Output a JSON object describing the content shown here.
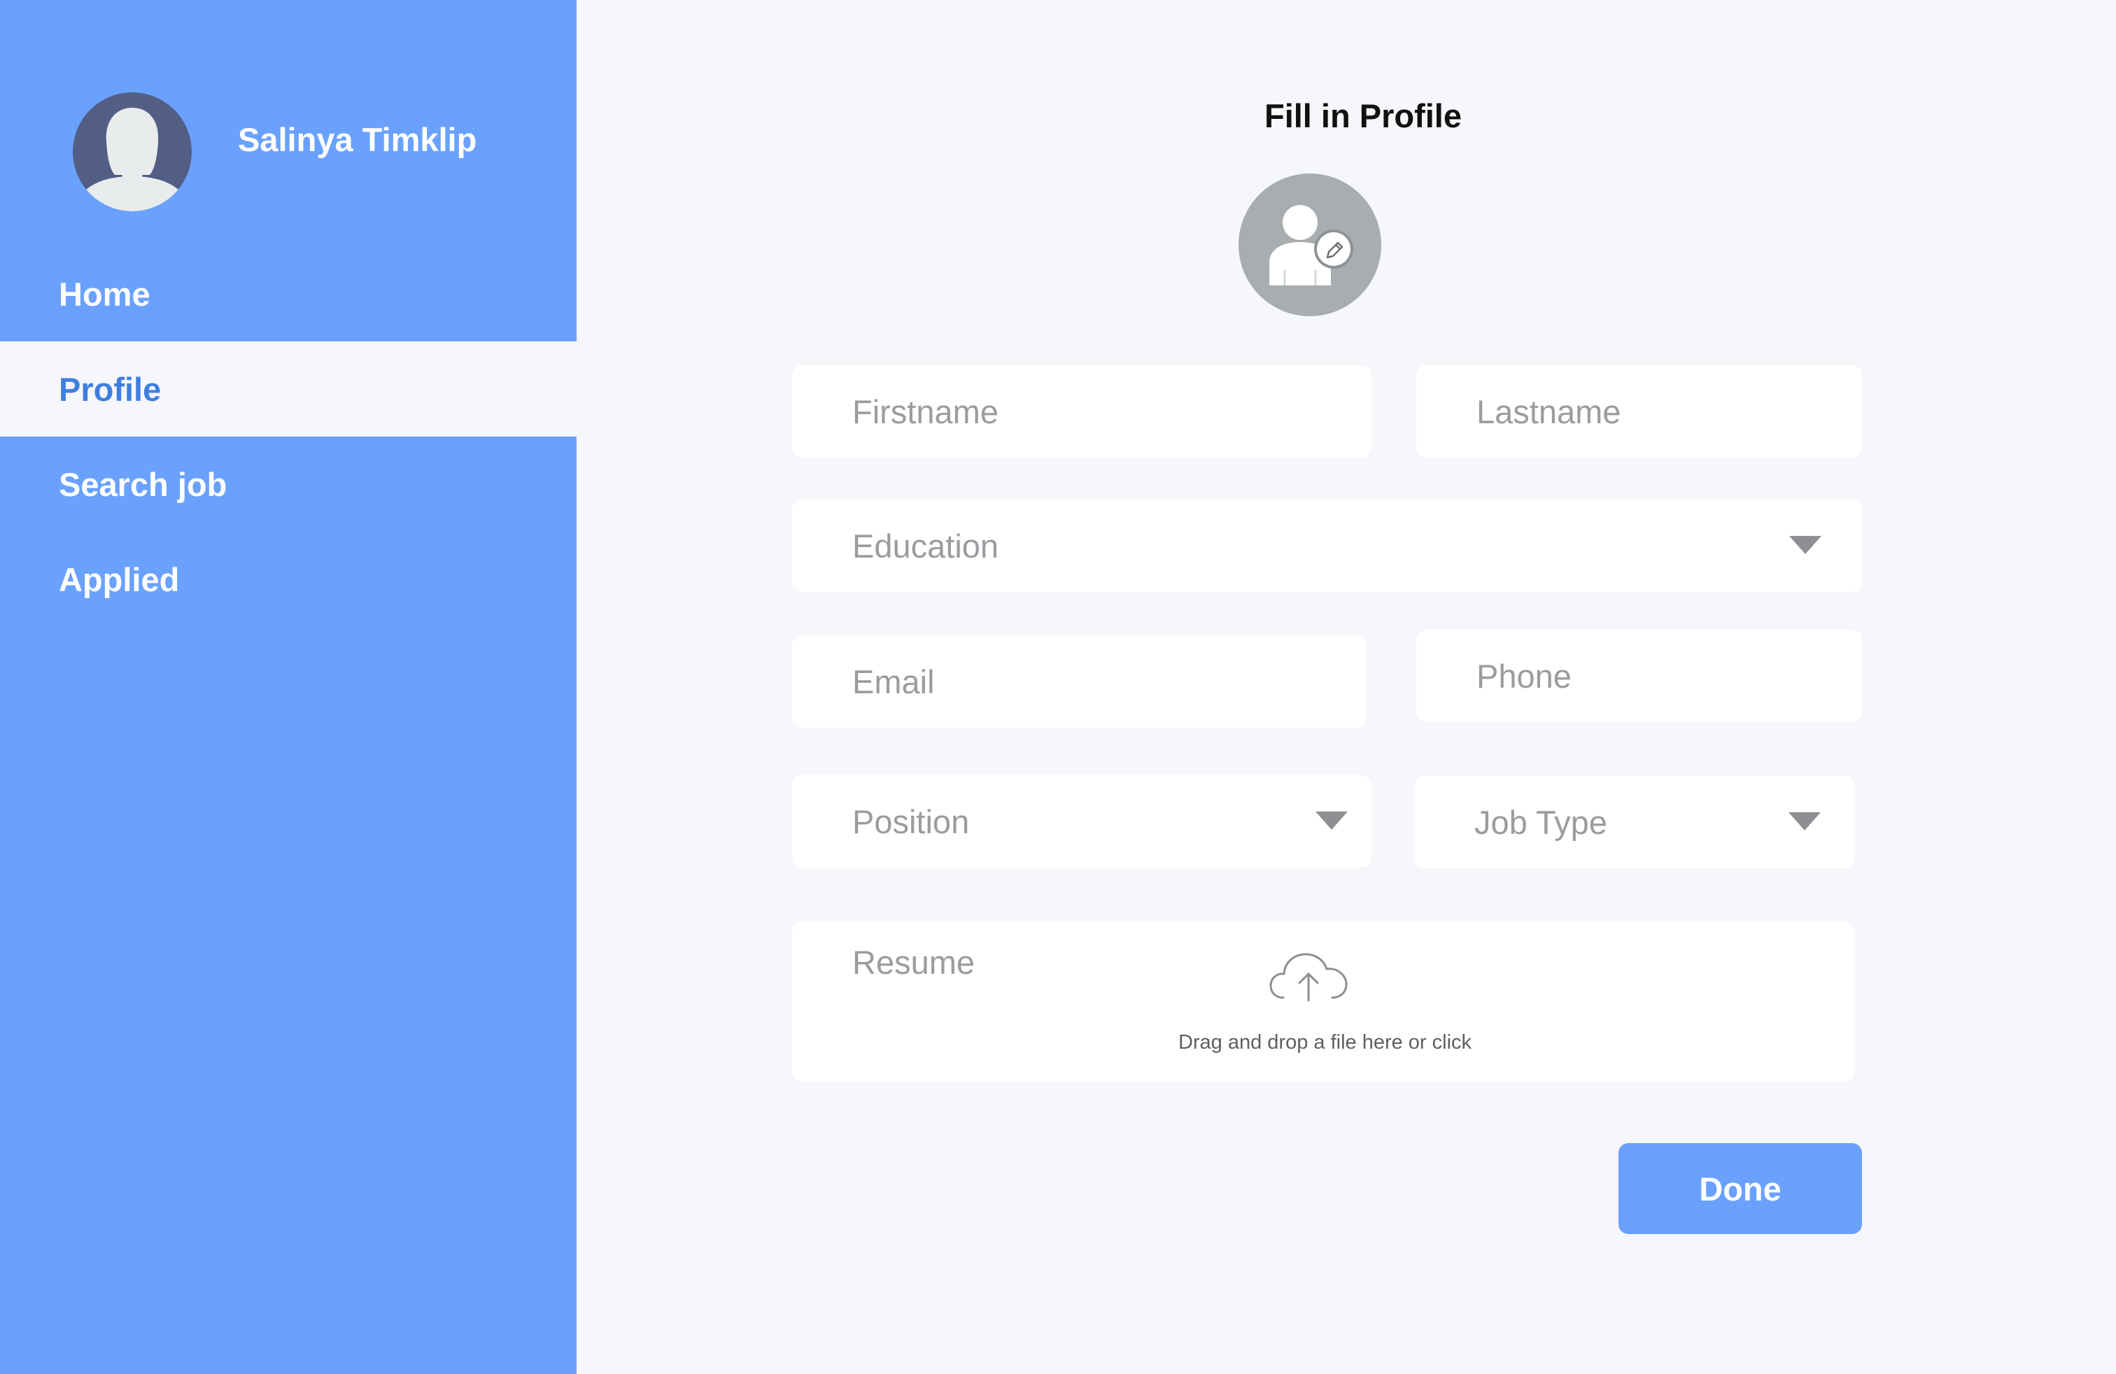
{
  "user": {
    "name": "Salinya Timklip"
  },
  "nav": {
    "items": [
      {
        "label": "Home",
        "active": false
      },
      {
        "label": "Profile",
        "active": true
      },
      {
        "label": "Search job",
        "active": false
      },
      {
        "label": "Applied",
        "active": false
      }
    ]
  },
  "form": {
    "title": "Fill in Profile",
    "firstname": {
      "placeholder": "Firstname",
      "value": ""
    },
    "lastname": {
      "placeholder": "Lastname",
      "value": ""
    },
    "education": {
      "placeholder": "Education",
      "value": ""
    },
    "email": {
      "placeholder": "Email",
      "value": ""
    },
    "phone": {
      "placeholder": "Phone",
      "value": ""
    },
    "position": {
      "placeholder": "Position",
      "value": ""
    },
    "job_type": {
      "placeholder": "Job Type",
      "value": ""
    },
    "resume": {
      "label": "Resume",
      "drop_text": "Drag and drop a file here or click"
    },
    "done_label": "Done"
  },
  "icons": {
    "avatar": "female-avatar-icon",
    "profile_photo": "user-edit-icon",
    "pencil": "pencil-icon",
    "dropdown": "chevron-down-icon",
    "upload": "cloud-upload-icon"
  },
  "colors": {
    "sidebar": "#6aa1fe",
    "active_nav_text": "#3f7fe0",
    "background": "#f6f7fa",
    "avatar_bg": "#525e84",
    "button": "#6aa1fe"
  }
}
